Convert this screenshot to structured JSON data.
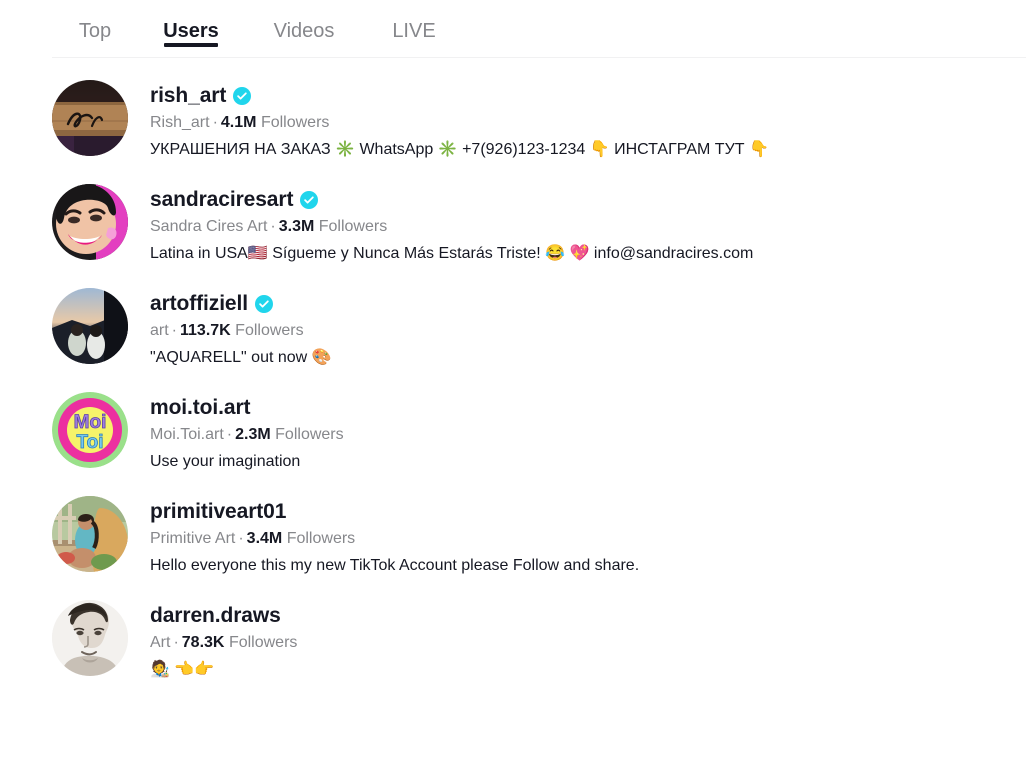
{
  "tabs": [
    {
      "label": "Top",
      "active": false,
      "name": "tab-top"
    },
    {
      "label": "Users",
      "active": true,
      "name": "tab-users"
    },
    {
      "label": "Videos",
      "active": false,
      "name": "tab-videos"
    },
    {
      "label": "LIVE",
      "active": false,
      "name": "tab-live"
    }
  ],
  "colors": {
    "verified_badge": "#20d5ec",
    "active_text": "#161823",
    "inactive_text": "#86878b",
    "secondary_text": "#86878b",
    "background": "#ffffff"
  },
  "users": [
    {
      "handle": "rish_art",
      "verified": true,
      "display_name": "Rish_art",
      "separator": "·",
      "follower_count": "4.1M",
      "followers_label": "Followers",
      "description": "УКРАШЕНИЯ НА ЗАКАЗ ✳️ WhatsApp ✳️ +7(926)123-1234 👇 ИНСТАГРАМ ТУТ 👇",
      "avatar_kind": "signature-artwork"
    },
    {
      "handle": "sandraciresart",
      "verified": true,
      "display_name": "Sandra Cires Art",
      "separator": "·",
      "follower_count": "3.3M",
      "followers_label": "Followers",
      "description": "Latina in USA🇺🇸 Sígueme y Nunca Más Estarás Triste! 😂 💖 info@sandracires.com",
      "avatar_kind": "woman-portrait"
    },
    {
      "handle": "artoffiziell",
      "verified": true,
      "display_name": "art",
      "separator": "·",
      "follower_count": "113.7K",
      "followers_label": "Followers",
      "description": "\"AQUARELL\" out now 🎨",
      "avatar_kind": "two-people-dusk"
    },
    {
      "handle": "moi.toi.art",
      "verified": false,
      "display_name": "Moi.Toi.art",
      "separator": "·",
      "follower_count": "2.3M",
      "followers_label": "Followers",
      "description": "Use your imagination",
      "avatar_kind": "moi-toi-logo"
    },
    {
      "handle": "primitiveart01",
      "verified": false,
      "display_name": "Primitive Art",
      "separator": "·",
      "follower_count": "3.4M",
      "followers_label": "Followers",
      "description": "Hello everyone this my new TikTok Account please Follow and share.",
      "avatar_kind": "woman-outdoors"
    },
    {
      "handle": "darren.draws",
      "verified": false,
      "display_name": "Art",
      "separator": "·",
      "follower_count": "78.3K",
      "followers_label": "Followers",
      "description": "🧑‍🎨 👈👉",
      "avatar_kind": "pencil-portrait"
    }
  ]
}
